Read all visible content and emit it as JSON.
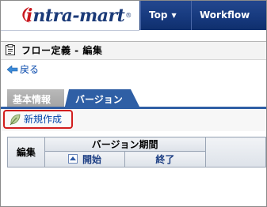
{
  "header": {
    "logo_i": "i",
    "logo_rest": "ntra-mart",
    "logo_reg": "®",
    "nav": [
      {
        "label": "Top"
      },
      {
        "label": "Workflow"
      }
    ]
  },
  "page": {
    "title": "フロー定義 - 編集",
    "back_label": "戻る"
  },
  "tabs": [
    {
      "label": "基本情報",
      "active": false
    },
    {
      "label": "バージョン",
      "active": true
    }
  ],
  "toolbar": {
    "new_label": "新規作成"
  },
  "table": {
    "headers": {
      "edit": "編集",
      "version_period": "バージョン期間",
      "start": "開始",
      "end": "終了",
      "extra": ""
    }
  },
  "colors": {
    "header_bg": "#173a7e",
    "accent": "#2f5fa5",
    "link": "#0044aa",
    "highlight_border": "#d21e1e"
  },
  "icons": {
    "logo": "intra-mart-logo",
    "caret": "chevron-down-icon",
    "title": "document-icon",
    "back": "back-arrow-icon",
    "new": "leaf-icon",
    "sort": "sort-ascending-icon"
  }
}
